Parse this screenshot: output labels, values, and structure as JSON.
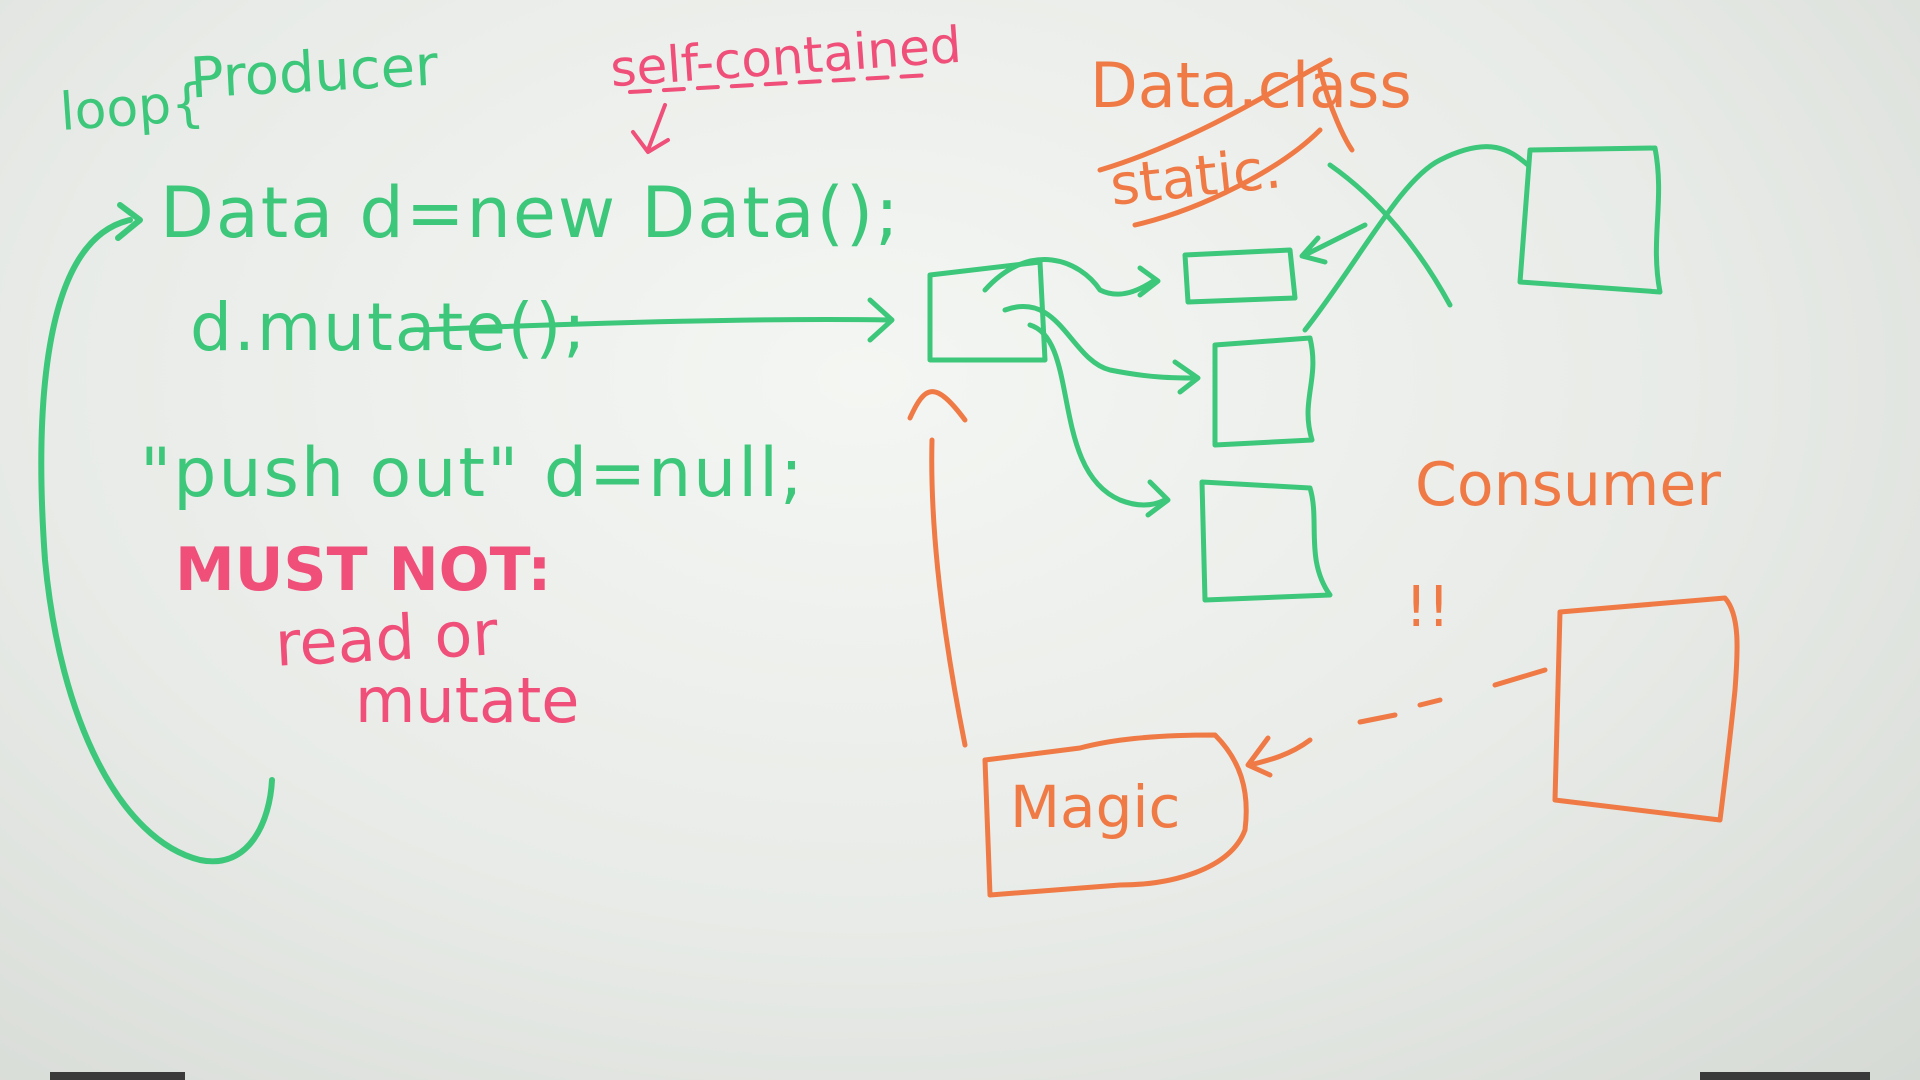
{
  "board": {
    "producer": {
      "loop_label": "loop{",
      "title": "Producer",
      "line1": "Data d=new Data();",
      "line2": "d.mutate();",
      "line3": "\"push out\" d=null;"
    },
    "annotation": {
      "text": "self-contained"
    },
    "warning": {
      "title": "MUST NOT:",
      "line1": "read or",
      "line2": "mutate"
    },
    "crossed_out": {
      "word1": "Data.class",
      "word2": "static."
    },
    "consumer": {
      "title": "Consumer",
      "exclaim": "!!"
    },
    "magic": {
      "label": "Magic"
    },
    "colors": {
      "green": "#3cc77a",
      "orange": "#f07a45",
      "pink": "#ef4f79"
    }
  }
}
